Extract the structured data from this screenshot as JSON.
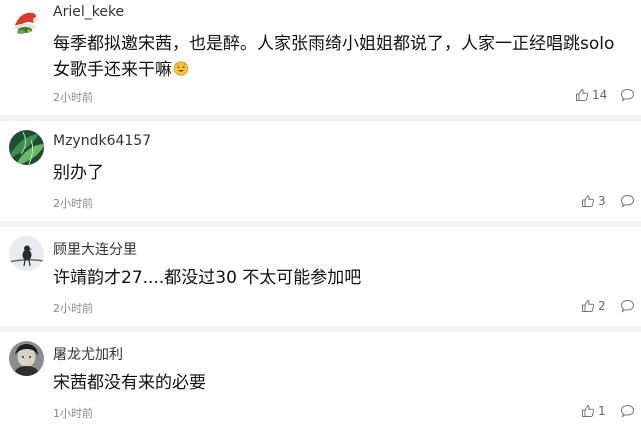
{
  "comments": [
    {
      "username": "Ariel_keke",
      "text": "每季都拟邀宋茜，也是醉。人家张雨绮小姐姐都说了，人家一正经唱跳solo女歌手还来干嘛",
      "time": "2小时前",
      "likes": "14",
      "avatar_icon": "santa-hat-icon"
    },
    {
      "username": "Mzyndk64157",
      "text": "别办了",
      "time": "2小时前",
      "likes": "3",
      "avatar_icon": "green-leaves-avatar"
    },
    {
      "username": "顾里大连分里",
      "text": "许靖韵才27....都没过30 不太可能参加吧",
      "time": "2小时前",
      "likes": "2",
      "avatar_icon": "bird-on-branch-avatar"
    },
    {
      "username": "屠龙尤加利",
      "text": "宋茜都没有来的必要",
      "time": "1小时前",
      "likes": "1",
      "avatar_icon": "portrait-avatar"
    }
  ],
  "icons": {
    "like": "thumbs-up-icon",
    "reply": "comment-bubble-icon",
    "emoji": "laughing-face-emoji"
  },
  "colors": {
    "divider": "#f2f2f2",
    "time": "#8a8a8a",
    "username": "#333333"
  }
}
